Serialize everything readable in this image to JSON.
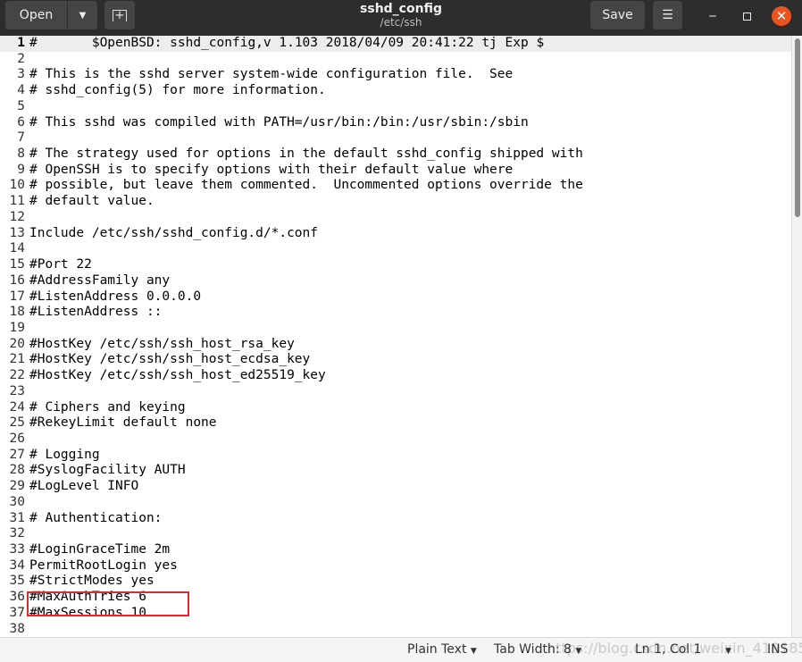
{
  "header": {
    "title": "sshd_config",
    "subtitle": "/etc/ssh",
    "open_label": "Open",
    "save_label": "Save",
    "icons": {
      "open_dropdown": "chevron-down-icon",
      "new_tab": "new-document-icon",
      "menu": "hamburger-icon",
      "minimize": "minimize-icon",
      "maximize": "maximize-icon",
      "close": "close-icon"
    }
  },
  "editor": {
    "current_line": 1,
    "highlight_color": "#e8262b",
    "lines": [
      "#\t$OpenBSD: sshd_config,v 1.103 2018/04/09 20:41:22 tj Exp $",
      "",
      "# This is the sshd server system-wide configuration file.  See",
      "# sshd_config(5) for more information.",
      "",
      "# This sshd was compiled with PATH=/usr/bin:/bin:/usr/sbin:/sbin",
      "",
      "# The strategy used for options in the default sshd_config shipped with",
      "# OpenSSH is to specify options with their default value where",
      "# possible, but leave them commented.  Uncommented options override the",
      "# default value.",
      "",
      "Include /etc/ssh/sshd_config.d/*.conf",
      "",
      "#Port 22",
      "#AddressFamily any",
      "#ListenAddress 0.0.0.0",
      "#ListenAddress ::",
      "",
      "#HostKey /etc/ssh/ssh_host_rsa_key",
      "#HostKey /etc/ssh/ssh_host_ecdsa_key",
      "#HostKey /etc/ssh/ssh_host_ed25519_key",
      "",
      "# Ciphers and keying",
      "#RekeyLimit default none",
      "",
      "# Logging",
      "#SyslogFacility AUTH",
      "#LogLevel INFO",
      "",
      "# Authentication:",
      "",
      "#LoginGraceTime 2m",
      "PermitRootLogin yes",
      "#StrictModes yes",
      "#MaxAuthTries 6",
      "#MaxSessions 10",
      ""
    ]
  },
  "status": {
    "language": "Plain Text",
    "tab_width": "Tab Width: 8",
    "position": "Ln 1, Col 1",
    "mode": "INS",
    "watermark": "https://blog.csdn.net/weixin_41918570"
  }
}
